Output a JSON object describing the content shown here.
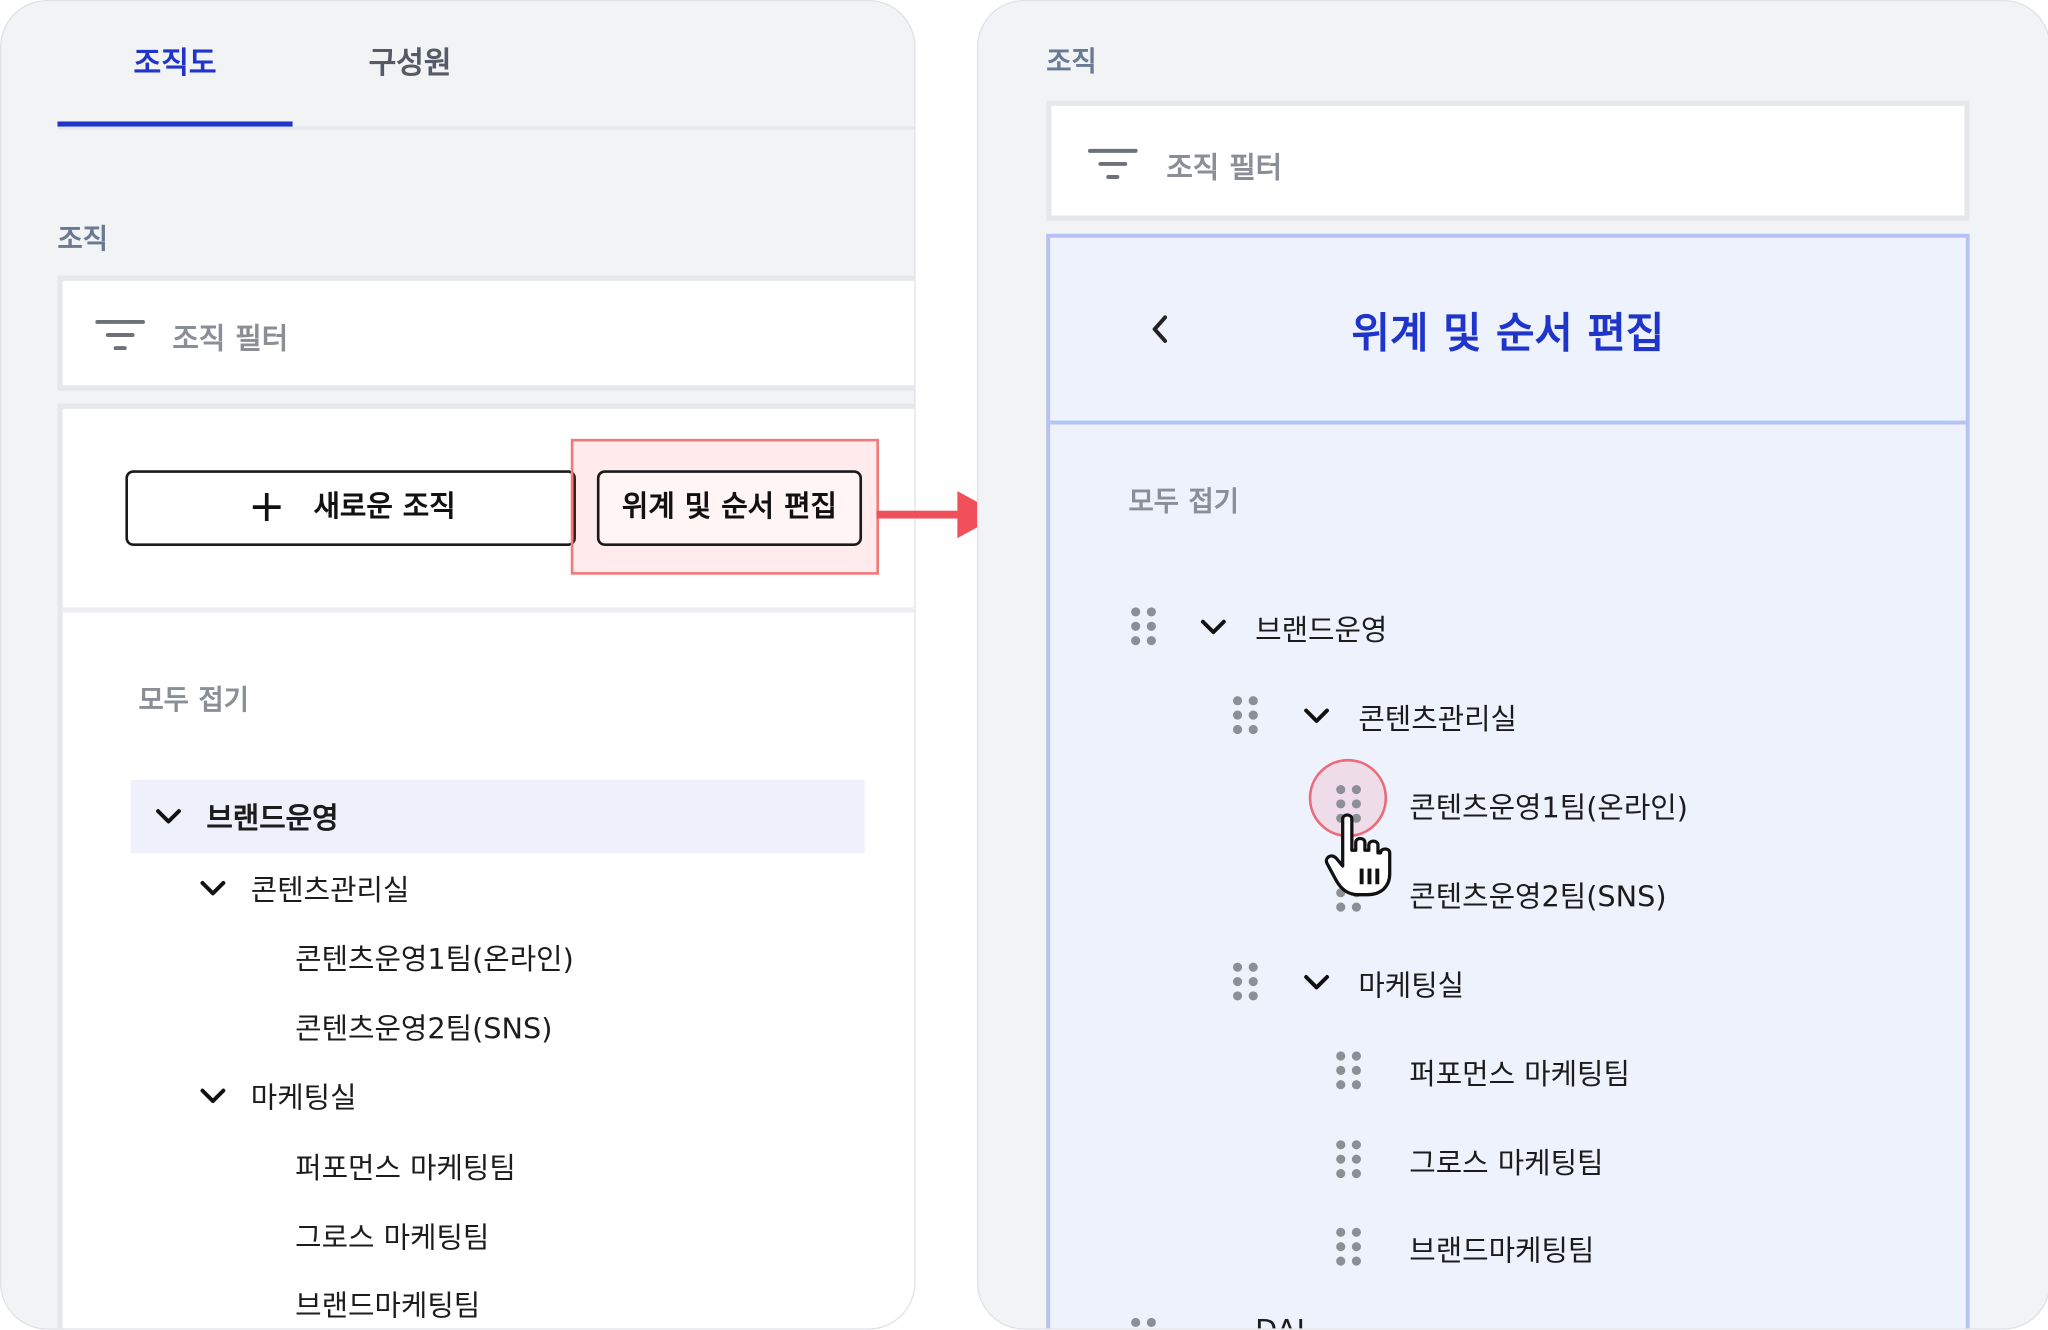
{
  "left": {
    "tabs": [
      {
        "label": "조직도"
      },
      {
        "label": "구성원"
      }
    ],
    "section_label": "조직",
    "filter_placeholder": "조직 필터",
    "new_org_button": "새로운 조직",
    "new_org_icon": "+",
    "edit_button": "위계 및 순서 편집",
    "collapse_all": "모두 접기",
    "tree": [
      "브랜드운영",
      "콘텐츠관리실",
      "콘텐츠운영1팀(온라인)",
      "콘텐츠운영2팀(SNS)",
      "마케팅실",
      "퍼포먼스 마케팅팀",
      "그로스 마케팅팀",
      "브랜드마케팅팀"
    ]
  },
  "right": {
    "section_label": "조직",
    "filter_placeholder": "조직 필터",
    "edit_title": "위계 및 순서 편집",
    "collapse_all": "모두 접기",
    "tree": [
      "브랜드운영",
      "콘텐츠관리실",
      "콘텐츠운영1팀(온라인)",
      "콘텐츠운영2팀(SNS)",
      "마케팅실",
      "퍼포먼스 마케팅팀",
      "그로스 마케팅팀",
      "브랜드마케팅팀",
      "DAI"
    ]
  },
  "colors": {
    "accent": "#1f35c9",
    "highlight_red": "#f07a7a",
    "arrow": "#f0505a",
    "edit_panel_bg": "#eef2fd"
  }
}
